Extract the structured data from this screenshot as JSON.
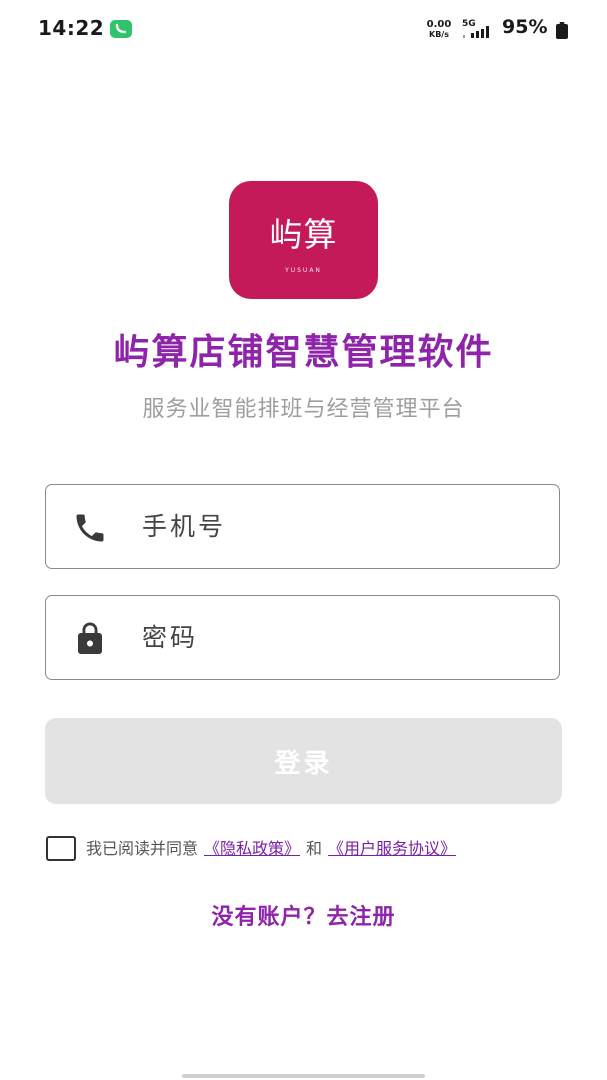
{
  "status_bar": {
    "time": "14:22",
    "net_speed_value": "0.00",
    "net_speed_unit": "KB/s",
    "network_type": "5G",
    "battery_percent": "95%",
    "icons": [
      "wechat-notification-icon",
      "signal-icon",
      "battery-icon"
    ]
  },
  "logo": {
    "text_cn": "屿算",
    "text_en": "YUSUAN"
  },
  "header": {
    "title": "屿算店铺智慧管理软件",
    "subtitle": "服务业智能排班与经营管理平台"
  },
  "form": {
    "phone": {
      "placeholder": "手机号",
      "value": "",
      "icon": "phone-icon"
    },
    "password": {
      "placeholder": "密码",
      "value": "",
      "icon": "lock-icon"
    },
    "login_label": "登录"
  },
  "agreement": {
    "checked": false,
    "prefix": "我已阅读并同意",
    "privacy_link": "《隐私政策》",
    "and": "和",
    "terms_link": "《用户服务协议》"
  },
  "register": {
    "label": "没有账户？去注册"
  },
  "colors": {
    "brand_purple": "#8e24aa",
    "logo_background": "#c41a5a",
    "link_purple": "#7b1fa2",
    "disabled_button": "#e3e3e3",
    "subtitle_gray": "#9e9e9e"
  }
}
